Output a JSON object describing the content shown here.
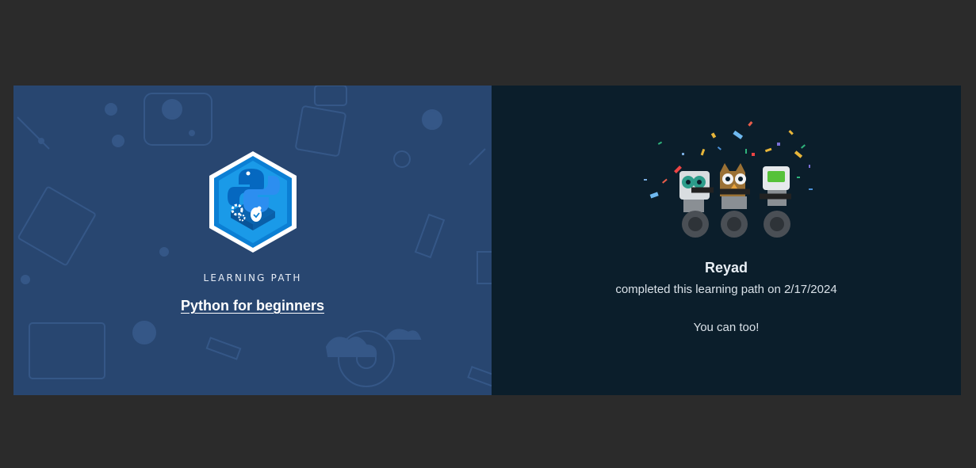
{
  "achievement": {
    "kicker": "LEARNING PATH",
    "title": "Python for beginners",
    "badge_icon": "python-learning-path-badge-icon"
  },
  "completion": {
    "user_name": "Reyad",
    "message": "completed this learning path on 2/17/2024",
    "cta": "You can too!",
    "illustration": "celebrating-robots-icon"
  },
  "colors": {
    "left_panel": "#284670",
    "right_panel": "#0b1e2b",
    "page_background": "#2b2b2b"
  }
}
